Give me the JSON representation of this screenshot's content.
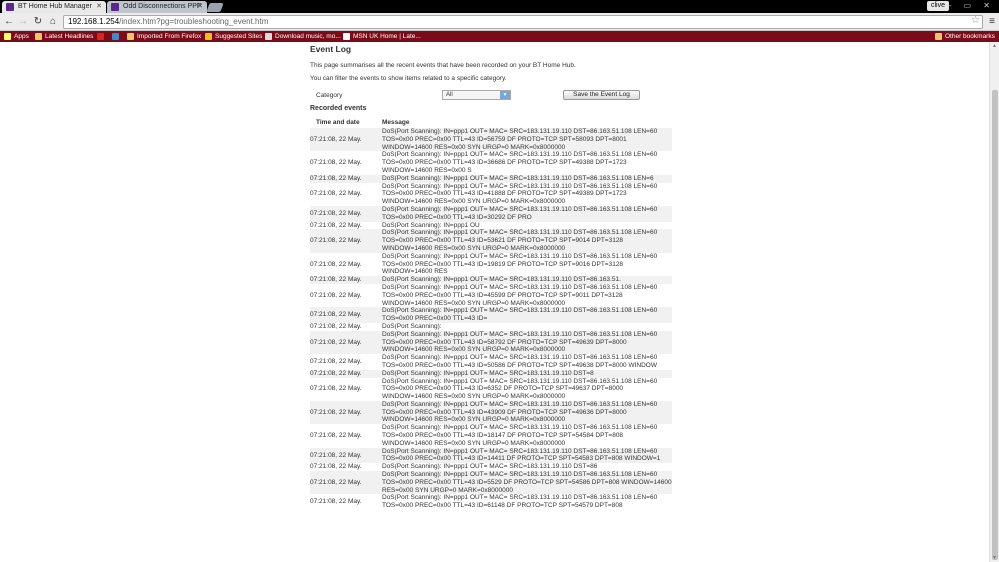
{
  "browser": {
    "tabs": [
      {
        "title": "BT Home Hub Manager",
        "active": true
      },
      {
        "title": "Odd Disconnections PPP",
        "active": false
      }
    ],
    "user": "clive",
    "url_host": "192.168.1.254",
    "url_path": "/index.htm?pg=troubleshooting_event.htm",
    "bookmarks": [
      {
        "label": "Apps",
        "icon": "apps-icon"
      },
      {
        "label": "Latest Headlines",
        "icon": "folder-icon"
      },
      {
        "label": "",
        "icon": "bookmark-red-icon"
      },
      {
        "label": "",
        "icon": "bookmark-blue-icon"
      },
      {
        "label": "Imported From Firefox",
        "icon": "folder-icon"
      },
      {
        "label": "Suggested Sites",
        "icon": "bookmark-icon"
      },
      {
        "label": "Download music, mo...",
        "icon": "bookmark-icon"
      },
      {
        "label": "MSN UK Home | Late...",
        "icon": "msn-icon"
      }
    ],
    "other_bookmarks": "Other bookmarks"
  },
  "page": {
    "title": "Event Log",
    "intro": "This page summarises all the recent events that have been recorded on your BT Home Hub.",
    "intro2": "You can filter the events to show items related to a specific category.",
    "category_label": "Category",
    "category_value": "All",
    "save_label": "Save the Event Log",
    "recorded_heading": "Recorded events",
    "col_time": "Time and date",
    "col_message": "Message"
  },
  "events": [
    {
      "time": "07:21:08, 22 May.",
      "msg": "DoS(Port Scanning): IN=ppp1 OUT= MAC= SRC=183.131.19.110 DST=86.163.51.108 LEN=60 TOS=0x00 PREC=0x00 TTL=43 ID=56759 DF PROTO=TCP SPT=58093 DPT=8001 WINDOW=14600 RES=0x00 SYN URGP=0 MARK=0x8000000"
    },
    {
      "time": "07:21:08, 22 May.",
      "msg": "DoS(Port Scanning): IN=ppp1 OUT= MAC= SRC=183.131.19.110 DST=86.163.51.108 LEN=60 TOS=0x00 PREC=0x00 TTL=43 ID=36686 DF PROTO=TCP SPT=49388 DPT=1723 WINDOW=14600 RES=0x00 S"
    },
    {
      "time": "07:21:08, 22 May.",
      "msg": "DoS(Port Scanning): IN=ppp1 OUT= MAC= SRC=183.131.19.110 DST=86.163.51.108 LEN=6"
    },
    {
      "time": "07:21:08, 22 May.",
      "msg": "DoS(Port Scanning): IN=ppp1 OUT= MAC= SRC=183.131.19.110 DST=86.163.51.108 LEN=60 TOS=0x00 PREC=0x00 TTL=43 ID=41888 DF PROTO=TCP SPT=49389 DPT=1723 WINDOW=14600 RES=0x00 SYN URGP=0 MARK=0x8000000"
    },
    {
      "time": "07:21:08, 22 May.",
      "msg": "DoS(Port Scanning): IN=ppp1 OUT= MAC= SRC=183.131.19.110 DST=86.163.51.108 LEN=60 TOS=0x00 PREC=0x00 TTL=43 ID=30292 DF PRO"
    },
    {
      "time": "07:21:08, 22 May.",
      "msg": "DoS(Port Scanning): IN=ppp1 OU"
    },
    {
      "time": "07:21:08, 22 May.",
      "msg": "DoS(Port Scanning): IN=ppp1 OUT= MAC= SRC=183.131.19.110 DST=86.163.51.108 LEN=60 TOS=0x00 PREC=0x00 TTL=43 ID=53621 DF PROTO=TCP SPT=9014 DPT=3128 WINDOW=14600 RES=0x00 SYN URGP=0 MARK=0x8000000"
    },
    {
      "time": "07:21:08, 22 May.",
      "msg": "DoS(Port Scanning): IN=ppp1 OUT= MAC= SRC=183.131.19.110 DST=86.163.51.108 LEN=60 TOS=0x00 PREC=0x00 TTL=43 ID=19819 DF PROTO=TCP SPT=9016 DPT=3128 WINDOW=14600 RES"
    },
    {
      "time": "07:21:08, 22 May.",
      "msg": "DoS(Port Scanning): IN=ppp1 OUT= MAC= SRC=183.131.19.110 DST=86.163.51."
    },
    {
      "time": "07:21:08, 22 May.",
      "msg": "DoS(Port Scanning): IN=ppp1 OUT= MAC= SRC=183.131.19.110 DST=86.163.51.108 LEN=60 TOS=0x00 PREC=0x00 TTL=43 ID=45599 DF PROTO=TCP SPT=9011 DPT=3128 WINDOW=14600 RES=0x00 SYN URGP=0 MARK=0x8000000"
    },
    {
      "time": "07:21:08, 22 May.",
      "msg": "DoS(Port Scanning): IN=ppp1 OUT= MAC= SRC=183.131.19.110 DST=86.163.51.108 LEN=60 TOS=0x00 PREC=0x00 TTL=43 ID="
    },
    {
      "time": "07:21:08, 22 May.",
      "msg": "DoS(Port Scanning):"
    },
    {
      "time": "07:21:08, 22 May.",
      "msg": "DoS(Port Scanning): IN=ppp1 OUT= MAC= SRC=183.131.19.110 DST=86.163.51.108 LEN=60 TOS=0x00 PREC=0x00 TTL=43 ID=58792 DF PROTO=TCP SPT=49639 DPT=8000 WINDOW=14600 RES=0x00 SYN URGP=0 MARK=0x8000000"
    },
    {
      "time": "07:21:08, 22 May.",
      "msg": "DoS(Port Scanning): IN=ppp1 OUT= MAC= SRC=183.131.19.110 DST=86.163.51.108 LEN=60 TOS=0x00 PREC=0x00 TTL=43 ID=50586 DF PROTO=TCP SPT=49638 DPT=8000 WINDOW"
    },
    {
      "time": "07:21:08, 22 May.",
      "msg": "DoS(Port Scanning): IN=ppp1 OUT= MAC= SRC=183.131.19.110 DST=8"
    },
    {
      "time": "07:21:08, 22 May.",
      "msg": "DoS(Port Scanning): IN=ppp1 OUT= MAC= SRC=183.131.19.110 DST=86.163.51.108 LEN=60 TOS=0x00 PREC=0x00 TTL=43 ID=6352 DF PROTO=TCP SPT=49637 DPT=8000 WINDOW=14600 RES=0x00 SYN URGP=0 MARK=0x8000000"
    },
    {
      "time": "07:21:08, 22 May.",
      "msg": "DoS(Port Scanning): IN=ppp1 OUT= MAC= SRC=183.131.19.110 DST=86.163.51.108 LEN=60 TOS=0x00 PREC=0x00 TTL=43 ID=43909 DF PROTO=TCP SPT=49636 DPT=8000 WINDOW=14600 RES=0x00 SYN URGP=0 MARK=0x8000000"
    },
    {
      "time": "07:21:08, 22 May.",
      "msg": "DoS(Port Scanning): IN=ppp1 OUT= MAC= SRC=183.131.19.110 DST=86.163.51.108 LEN=60 TOS=0x00 PREC=0x00 TTL=43 ID=18147 DF PROTO=TCP SPT=54584 DPT=808 WINDOW=14600 RES=0x00 SYN URGP=0 MARK=0x8000000"
    },
    {
      "time": "07:21:08, 22 May.",
      "msg": "DoS(Port Scanning): IN=ppp1 OUT= MAC= SRC=183.131.19.110 DST=86.163.51.108 LEN=60 TOS=0x00 PREC=0x00 TTL=43 ID=14411 DF PROTO=TCP SPT=54583 DPT=808 WINDOW=1"
    },
    {
      "time": "07:21:08, 22 May.",
      "msg": "DoS(Port Scanning): IN=ppp1 OUT= MAC= SRC=183.131.19.110 DST=86"
    },
    {
      "time": "07:21:08, 22 May.",
      "msg": "DoS(Port Scanning): IN=ppp1 OUT= MAC= SRC=183.131.19.110 DST=86.163.51.108 LEN=60 TOS=0x00 PREC=0x00 TTL=43 ID=5529 DF PROTO=TCP SPT=54586 DPT=808 WINDOW=14600 RES=0x00 SYN URGP=0 MARK=0x8000000"
    },
    {
      "time": "07:21:08, 22 May.",
      "msg": "DoS(Port Scanning): IN=ppp1 OUT= MAC= SRC=183.131.19.110 DST=86.163.51.108 LEN=60 TOS=0x00 PREC=0x00 TTL=43 ID=61148 DF PROTO=TCP SPT=54579 DPT=808"
    }
  ],
  "colors": {
    "bookmark_bar": "#7a0c1a",
    "row_alt": "#f1f1f1",
    "select_arrow": "#7aa6d6"
  }
}
